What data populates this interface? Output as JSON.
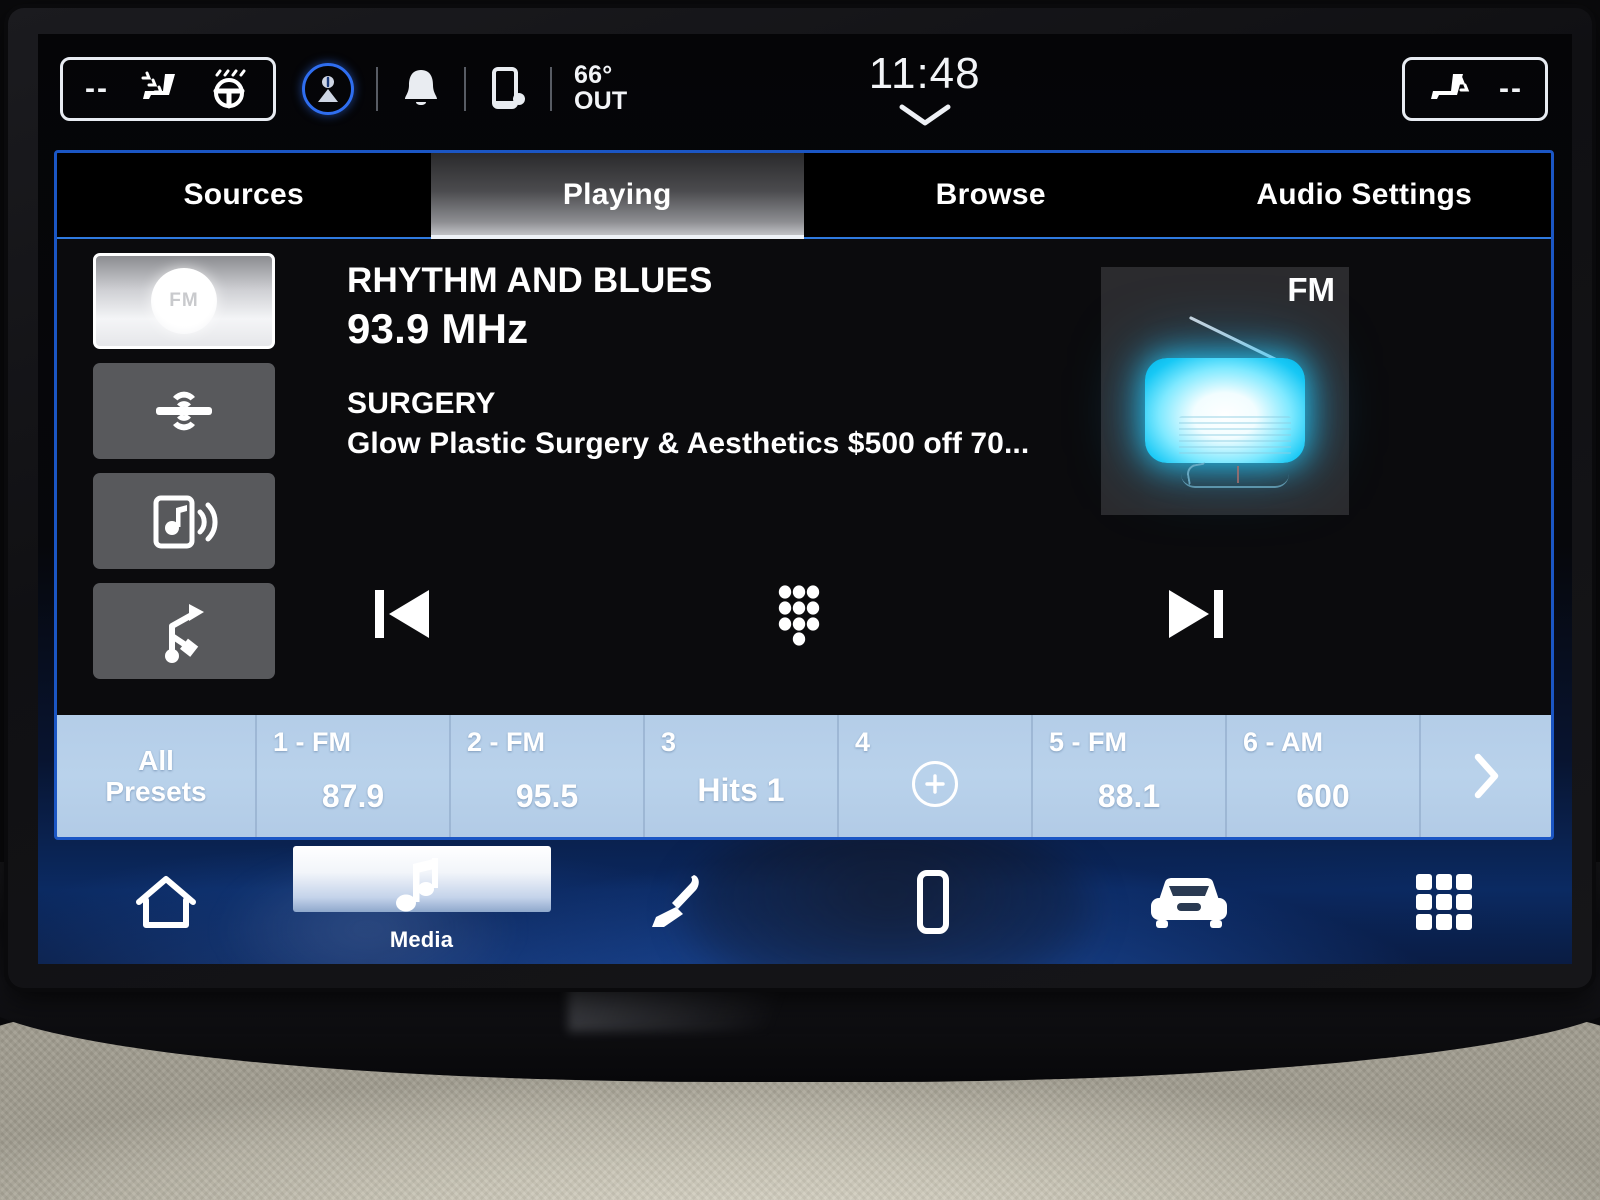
{
  "status_bar": {
    "driver_climate": {
      "name": "driver-climate",
      "value": "--",
      "icons": [
        "heated-seat-icon",
        "heated-steering-wheel-icon"
      ]
    },
    "passenger_climate": {
      "name": "passenger-climate",
      "value": "--",
      "icons": [
        "heated-seat-icon"
      ]
    },
    "profile_icon": "user-profile-icon",
    "notification_icon": "bell-icon",
    "phone_icon": "phone-icon",
    "temperature": {
      "value": "66°",
      "label": "OUT"
    },
    "clock": "11:48",
    "pulldown_icon": "chevron-down-icon"
  },
  "tabs": [
    {
      "label": "Sources",
      "active": false
    },
    {
      "label": "Playing",
      "active": true
    },
    {
      "label": "Browse",
      "active": false
    },
    {
      "label": "Audio Settings",
      "active": false
    }
  ],
  "sources": [
    {
      "name": "source-fm",
      "icon": "fm-radio-icon",
      "label": "FM",
      "active": true
    },
    {
      "name": "source-satellite",
      "icon": "satellite-radio-icon",
      "label": "",
      "active": false
    },
    {
      "name": "source-bluetooth-audio",
      "icon": "bluetooth-audio-icon",
      "label": "",
      "active": false
    },
    {
      "name": "source-usb",
      "icon": "usb-icon",
      "label": "",
      "active": false
    }
  ],
  "now_playing": {
    "station": "RHYTHM AND BLUES",
    "frequency": "93.9 MHz",
    "category": "SURGERY",
    "radio_text": "Glow Plastic Surgery & Aesthetics $500 off 70...",
    "art_band": "FM",
    "art_icon": "retro-radio-icon"
  },
  "transport": {
    "previous": {
      "label": "previous-track-icon"
    },
    "keypad": {
      "label": "direct-tune-keypad-icon"
    },
    "next": {
      "label": "next-track-icon"
    }
  },
  "presets": {
    "all_presets_line1": "All",
    "all_presets_line2": "Presets",
    "items": [
      {
        "num": "1 - FM",
        "value": "87.9",
        "type": "value"
      },
      {
        "num": "2 - FM",
        "value": "95.5",
        "type": "value"
      },
      {
        "num": "3",
        "value": "Hits 1",
        "type": "value"
      },
      {
        "num": "4",
        "value": "",
        "type": "add"
      },
      {
        "num": "5 - FM",
        "value": "88.1",
        "type": "value"
      },
      {
        "num": "6 - AM",
        "value": "600",
        "type": "value"
      }
    ],
    "next_page_icon": "chevron-right-icon"
  },
  "nav": [
    {
      "name": "nav-home",
      "icon": "home-icon",
      "label": "",
      "active": false
    },
    {
      "name": "nav-media",
      "icon": "music-note-icon",
      "label": "Media",
      "active": true
    },
    {
      "name": "nav-climate",
      "icon": "seat-climate-icon",
      "label": "",
      "active": false
    },
    {
      "name": "nav-phone",
      "icon": "phone-icon",
      "label": "",
      "active": false
    },
    {
      "name": "nav-vehicle",
      "icon": "car-front-icon",
      "label": "",
      "active": false
    },
    {
      "name": "nav-apps",
      "icon": "apps-grid-icon",
      "label": "",
      "active": false
    }
  ],
  "colors": {
    "accent_border": "#1b56c4",
    "tab_underline": "#2f7ae0",
    "preset_bar": "#b9d2eb",
    "profile_ring": "#2f6ef0",
    "radio_glow": "#17c8f5"
  }
}
